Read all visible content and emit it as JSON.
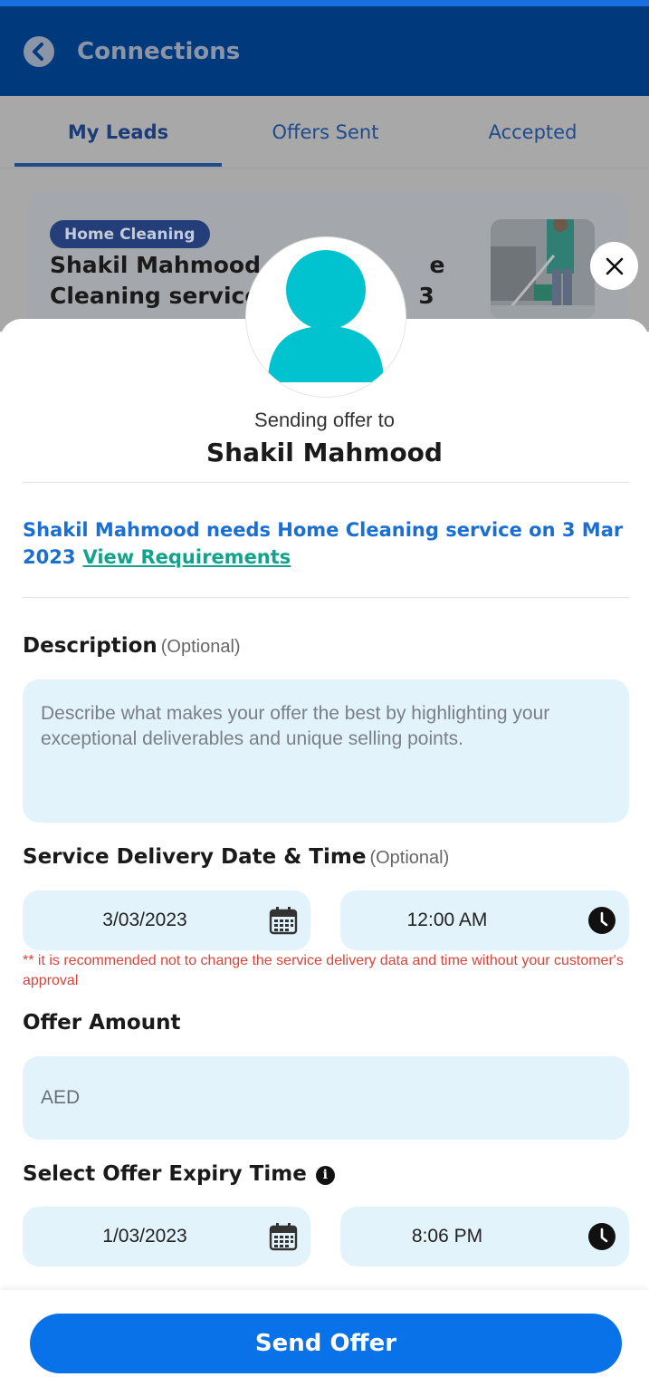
{
  "header": {
    "title": "Connections"
  },
  "tabs": [
    {
      "label": "My Leads",
      "active": true
    },
    {
      "label": "Offers Sent",
      "active": false
    },
    {
      "label": "Accepted",
      "active": false
    }
  ],
  "lead_card": {
    "category": "Home Cleaning",
    "title_visible_line1": "Shakil Mahmood n",
    "title_visible_line1_tail": "e",
    "title_visible_line2": "Cleaning service",
    "title_visible_line2_tail": "3"
  },
  "offer": {
    "sending_label": "Sending offer to",
    "recipient_name": "Shakil Mahmood",
    "needs_text": "Shakil Mahmood needs Home Cleaning service on  3 Mar 2023",
    "view_requirements": "View Requirements"
  },
  "description": {
    "label": "Description",
    "optional": "(Optional)",
    "placeholder": "Describe what makes your offer the best by highlighting your exceptional deliverables and unique selling points."
  },
  "delivery": {
    "label": "Service Delivery Date & Time",
    "optional": "(Optional)",
    "date": "3/03/2023",
    "time": "12:00 AM",
    "warning": "** it is recommended not to change the service delivery data and time without your customer's approval"
  },
  "amount": {
    "label": "Offer Amount",
    "placeholder": "AED"
  },
  "expiry": {
    "label": "Select Offer Expiry Time",
    "date": "1/03/2023",
    "time": "8:06 PM"
  },
  "actions": {
    "send_label": "Send Offer"
  },
  "colors": {
    "primary": "#0a72e8",
    "header_bg": "#003a7d",
    "field_bg": "#e3f3fc",
    "link": "#1a6fd1",
    "accent_link": "#11a38b",
    "warning": "#d9453b"
  },
  "icons": [
    "back-arrow-icon",
    "close-icon",
    "avatar-icon",
    "calendar-icon",
    "clock-icon",
    "info-icon"
  ]
}
